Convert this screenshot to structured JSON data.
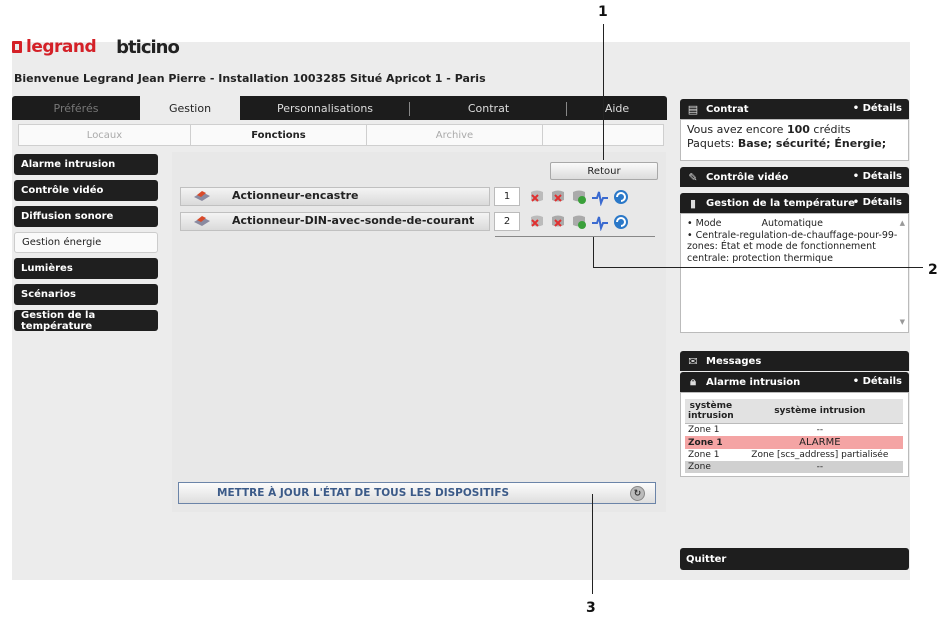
{
  "brand": {
    "logo_primary": "legrand",
    "logo_secondary": "bticino"
  },
  "welcome": "Bienvenue Legrand Jean Pierre - Installation 1003285 Situé Apricot 1 - Paris",
  "tabs": [
    {
      "label": "Préférés"
    },
    {
      "label": "Gestion"
    },
    {
      "label": "Personnalisations"
    },
    {
      "label": "Contrat"
    },
    {
      "label": "Aide"
    }
  ],
  "subtabs": [
    {
      "label": "Locaux"
    },
    {
      "label": "Fonctions"
    },
    {
      "label": "Archive"
    }
  ],
  "sidebar": [
    {
      "label": "Alarme intrusion"
    },
    {
      "label": "Contrôle vidéo"
    },
    {
      "label": "Diffusion sonore"
    },
    {
      "label": "Gestion énergie"
    },
    {
      "label": "Lumières"
    },
    {
      "label": "Scénarios"
    },
    {
      "label": "Gestion de la température"
    }
  ],
  "main": {
    "back_button": "Retour",
    "devices": [
      {
        "name": "Actionneur-encastre",
        "number": "1"
      },
      {
        "name": "Actionneur-DIN-avec-sonde-de-courant",
        "number": "2"
      }
    ],
    "update_all": "METTRE À JOUR L'ÉTAT DE TOUS LES DISPOSITIFS"
  },
  "right_panel": {
    "contract": {
      "title": "Contrat",
      "details": "• Détails",
      "line1_prefix": "Vous avez encore ",
      "line1_value": "100",
      "line1_suffix": " crédits",
      "line2_prefix": "Paquets: ",
      "line2_value": "Base; sécurité; Énergie;"
    },
    "video": {
      "title": "Contrôle vidéo",
      "details": "• Détails"
    },
    "temperature": {
      "title": "Gestion de la température",
      "details": "• Détails",
      "mode_label": "• Mode",
      "mode_value": "Automatique",
      "line2": "• Centrale-regulation-de-chauffage-pour-99-zones: État et mode de fonctionnement centrale: protection thermique"
    },
    "messages": {
      "title": "Messages"
    },
    "alarm": {
      "title": "Alarme intrusion",
      "details": "• Détails",
      "headers": [
        "système intrusion",
        "système intrusion"
      ],
      "rows": [
        {
          "zone": "Zone 1",
          "status": "--"
        },
        {
          "zone": "Zone 1",
          "status": "ALARME"
        },
        {
          "zone": "Zone 1",
          "status": "Zone [scs_address] partialisée"
        },
        {
          "zone": "Zone",
          "status": "--"
        }
      ]
    },
    "quit": "Quitter"
  },
  "callouts": [
    "1",
    "2",
    "3"
  ],
  "colors": {
    "dark_bar": "#1e1e1e",
    "alarm_row": "#f4a4a4",
    "brand_red": "#d42027",
    "update_text": "#3b5a88"
  }
}
